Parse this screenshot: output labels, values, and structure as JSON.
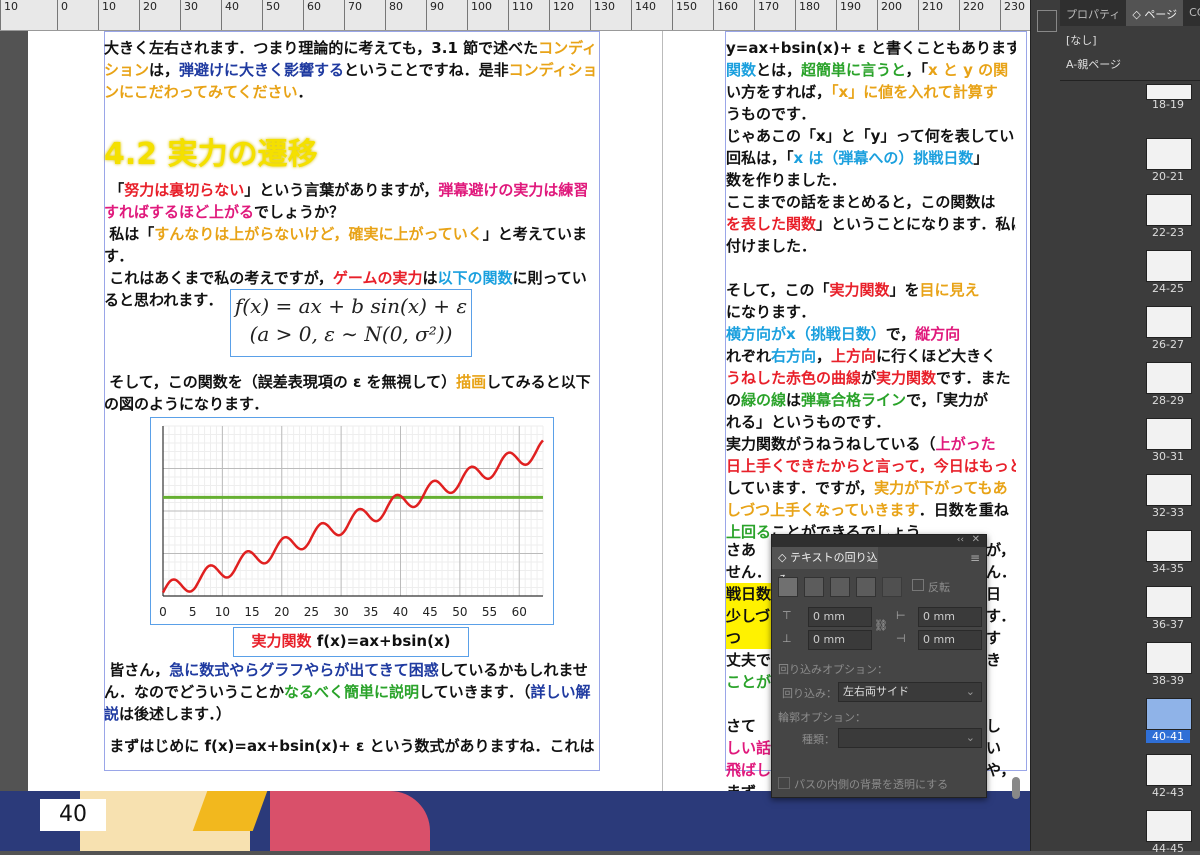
{
  "ruler": {
    "ticks": [
      "10",
      "0",
      "10",
      "20",
      "30",
      "40",
      "50",
      "60",
      "70",
      "80",
      "90",
      "100",
      "110",
      "120",
      "130",
      "140",
      "150",
      "160",
      "170",
      "180",
      "190",
      "200",
      "210",
      "220",
      "230",
      "240"
    ]
  },
  "left_page": {
    "para0": [
      "大きく左右されます．つまり理論的に考えても，3.1 節で述べた",
      "コンディション",
      "は，",
      "弾避けに大きく影響する",
      "ということですね．是非",
      "コンディションにこだわってみてください",
      "．"
    ],
    "heading": "4.2 実力の遷移",
    "para1": [
      "「",
      "努力は裏切らない",
      "」という言葉がありますが，",
      "弾幕避けの実力は練習すればするほど上がる",
      "でしょうか？"
    ],
    "para2": [
      "私は「",
      "すんなりは上がらないけど，確実に上がっていく",
      "」と考えています．"
    ],
    "para3": [
      "これはあくまで私の考えですが，",
      "ゲームの実力",
      "は",
      "以下の関数",
      "に則っていると思われます．"
    ],
    "formula_line1": "f(x) = ax + b sin(x) + ε",
    "formula_line2": "(a > 0,  ε ∼ N(0, σ²))",
    "para4": [
      "そして，この関数を（誤差表現項の ε を無視して）",
      "描画",
      "してみると以下の図のようになります．"
    ],
    "caption": [
      "実力関数",
      " f(x)=ax+bsin(x)"
    ],
    "para5": [
      "皆さん，",
      "急に数式やらグラフやらが出てきて困惑",
      "しているかもしれません．なのでどういうことか",
      "なるべく簡単に説明",
      "していきます．（",
      "詳しい解説",
      "は後述します．）"
    ],
    "para6": "まずはじめに f(x)=ax+bsin(x)+ ε という数式がありますね．これは",
    "page_number": "40"
  },
  "right_page": {
    "lines": [
      [
        "y=ax+bsin(x)+ ε と書くこともあります．（以"
      ],
      [
        "関数",
        "とは，",
        "超簡単に言うと",
        "，「",
        "x と y の関"
      ],
      [
        "い方をすれば，",
        "「x」に値を入れて計算す"
      ],
      [
        "うものです．"
      ],
      [
        "じゃあこの「x」と「y」って何を表してい"
      ],
      [
        "回私は，「",
        "x は（弾幕への）挑戦日数",
        "」"
      ],
      [
        "数を作りました．"
      ],
      [
        "ここまでの話をまとめると，この関数は"
      ],
      [
        "を表した関数",
        "」ということになります．私は"
      ],
      [
        "付けました．"
      ],
      [
        ""
      ],
      [
        "そして，この「",
        "実力関数",
        "」を",
        "目に見え"
      ],
      [
        "になります．"
      ],
      [
        "横方向が",
        "x（挑戦日数）",
        "で，",
        "縦方向"
      ],
      [
        "れぞれ",
        "右方向",
        "，",
        "上方向",
        "に行くほど大きく"
      ],
      [
        "うねした赤色の曲線",
        "が",
        "実力関数",
        "です．また"
      ],
      [
        "の",
        "緑の線",
        "は",
        "弾幕合格ライン",
        "で，「実力が"
      ],
      [
        "れる」というものです．"
      ],
      [
        "実力関数がうねうねしている（",
        "上がった"
      ],
      [
        "日上手くできたからと言って，今日はもっと"
      ],
      [
        "しています．ですが，",
        "実力が下がってもあ"
      ],
      [
        "しづつ上手くなっていきます",
        "．日数を重ね"
      ],
      [
        "上回る",
        "ことができるでしょう．"
      ]
    ],
    "lower_lines": [
      "さあ",
      "せん．",
      "戦日数",
      "少しづつ",
      "丈夫で",
      "ことが",
      "",
      "さて",
      "しい話",
      "飛ばし",
      "まず"
    ],
    "lower_right": [
      "が，",
      "ん．",
      "日",
      "す．",
      "すき",
      "",
      "",
      "しい",
      "や，",
      "",
      "各"
    ]
  },
  "chart_data": {
    "type": "line",
    "x_ticks": [
      "0",
      "5",
      "10",
      "15",
      "20",
      "25",
      "30",
      "35",
      "40",
      "45",
      "50",
      "55",
      "60"
    ],
    "xlim": [
      0,
      64
    ],
    "ylim": [
      0,
      1
    ],
    "series": [
      {
        "color": "#e02020",
        "function": "a*x + b*sin(x)",
        "a": 0.0132,
        "b": 0.055,
        "offset": 0.02
      },
      {
        "color": "#66b032",
        "constant": 0.58
      }
    ],
    "grid": true
  },
  "wrap_panel": {
    "title": "テキストの回り込み",
    "invert_label": "反転",
    "top_offset": "0 mm",
    "bottom_offset": "0 mm",
    "left_offset": "0 mm",
    "right_offset": "0 mm",
    "wrap_options_label": "回り込みオプション：",
    "wrap_to_label": "回り込み：",
    "wrap_to_value": "左右両サイド",
    "contour_label": "輪郭オプション：",
    "type_label": "種類：",
    "type_value": "",
    "transparent_label": "パスの内側の背景を透明にする"
  },
  "pages_panel": {
    "tabs": [
      "プロパティ",
      "ページ",
      "CC"
    ],
    "none_label": "[なし]",
    "master_label": "A-親ページ",
    "spreads": [
      "18-19",
      "20-21",
      "22-23",
      "24-25",
      "26-27",
      "28-29",
      "30-31",
      "32-33",
      "34-35",
      "36-37",
      "38-39",
      "40-41",
      "42-43",
      "44-45"
    ],
    "selected": "40-41"
  }
}
